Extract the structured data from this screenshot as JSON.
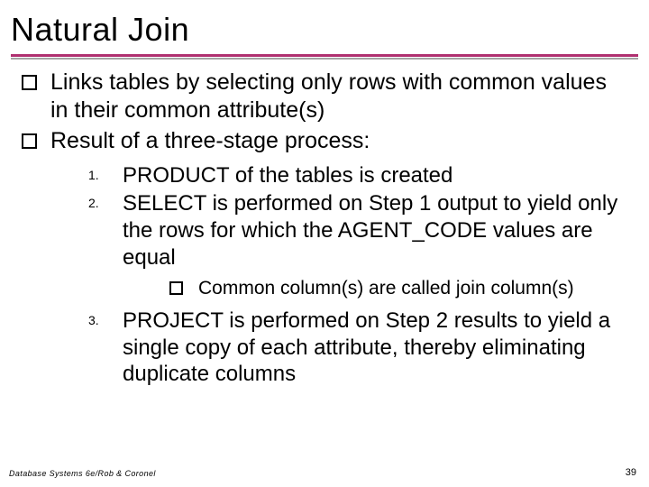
{
  "title": "Natural Join",
  "bullets": [
    "Links tables by selecting only rows with common values in their common attribute(s)",
    "Result of a three-stage process:"
  ],
  "steps": [
    {
      "num": "1.",
      "text": "PRODUCT of the tables is created"
    },
    {
      "num": "2.",
      "text": "SELECT is performed on Step 1 output to yield only the rows for which the AGENT_CODE values are equal"
    },
    {
      "num": "3.",
      "text": "PROJECT is performed on Step 2 results to yield a single copy of each attribute, thereby eliminating duplicate columns"
    }
  ],
  "sub_note": "Common column(s) are called join column(s)",
  "footer_left": "Database Systems 6e/Rob & Coronel",
  "footer_right": "39"
}
